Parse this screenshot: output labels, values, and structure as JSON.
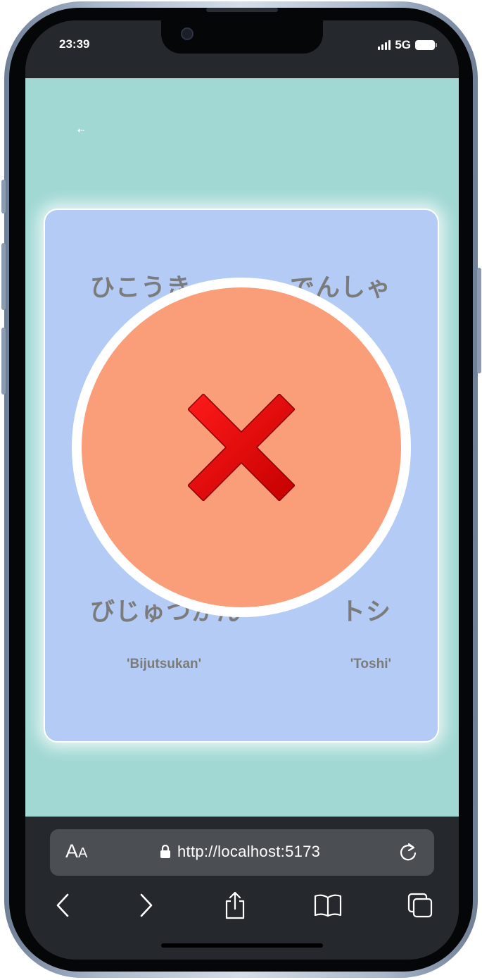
{
  "status": {
    "time": "23:39",
    "network": "5G"
  },
  "page": {
    "back_label": "⇠",
    "cards": [
      {
        "kana": "ひこうき",
        "romaji": ""
      },
      {
        "kana": "でんしゃ",
        "romaji": ""
      },
      {
        "kana": "びじゅつかん",
        "romaji": "'Bijutsukan'"
      },
      {
        "kana": "トシ",
        "romaji": "'Toshi'"
      }
    ],
    "result": {
      "icon": "close-icon",
      "state": "incorrect",
      "color": "#fa9d79",
      "cross_color": "#e00000"
    }
  },
  "browser": {
    "text_size_label_big": "A",
    "text_size_label_small": "A",
    "url": "http://localhost:5173",
    "toolbar": [
      "back-icon",
      "forward-icon",
      "share-icon",
      "bookmarks-icon",
      "tabs-icon"
    ]
  },
  "colors": {
    "background": "#a1d8d4",
    "card": "#b3cbf5",
    "chrome": "#25292d"
  }
}
